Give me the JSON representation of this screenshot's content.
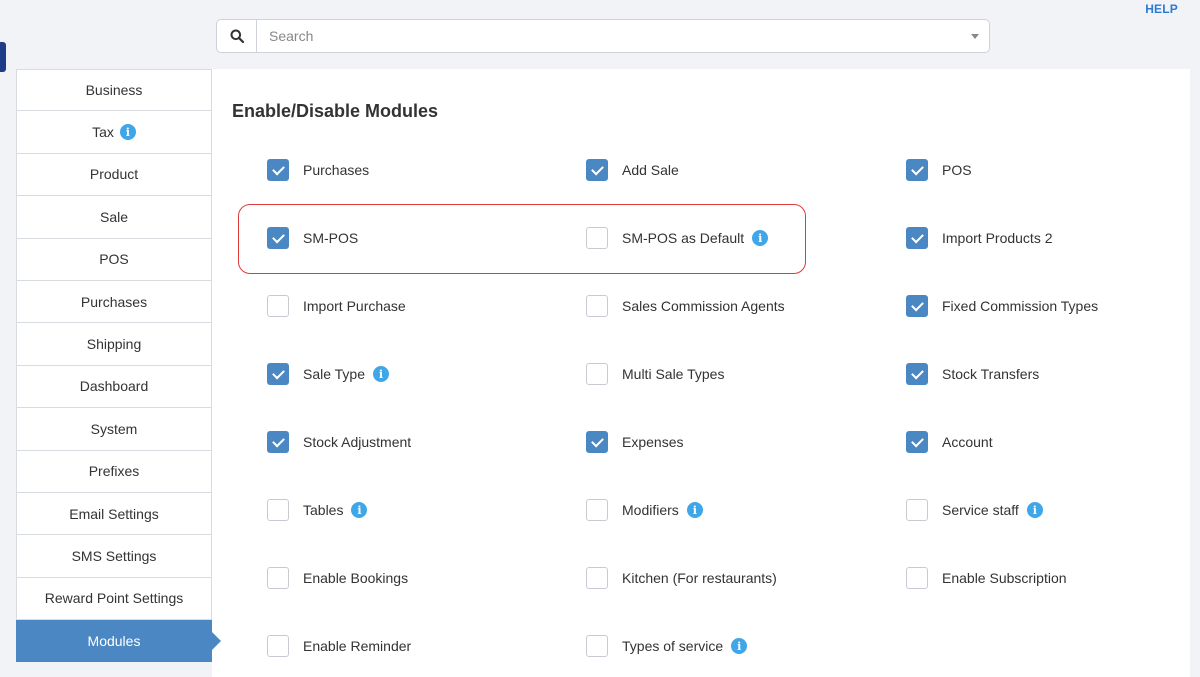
{
  "header": {
    "help_label": "HELP",
    "search_placeholder": "Search"
  },
  "sidebar": {
    "items": [
      {
        "label": "Business",
        "info": false,
        "active": false
      },
      {
        "label": "Tax",
        "info": true,
        "active": false
      },
      {
        "label": "Product",
        "info": false,
        "active": false
      },
      {
        "label": "Sale",
        "info": false,
        "active": false
      },
      {
        "label": "POS",
        "info": false,
        "active": false
      },
      {
        "label": "Purchases",
        "info": false,
        "active": false
      },
      {
        "label": "Shipping",
        "info": false,
        "active": false
      },
      {
        "label": "Dashboard",
        "info": false,
        "active": false
      },
      {
        "label": "System",
        "info": false,
        "active": false
      },
      {
        "label": "Prefixes",
        "info": false,
        "active": false
      },
      {
        "label": "Email Settings",
        "info": false,
        "active": false
      },
      {
        "label": "SMS Settings",
        "info": false,
        "active": false
      },
      {
        "label": "Reward Point Settings",
        "info": false,
        "active": false
      },
      {
        "label": "Modules",
        "info": false,
        "active": true
      }
    ]
  },
  "main": {
    "title": "Enable/Disable Modules",
    "modules": [
      {
        "label": "Purchases",
        "checked": true,
        "info": false
      },
      {
        "label": "Add Sale",
        "checked": true,
        "info": false
      },
      {
        "label": "POS",
        "checked": true,
        "info": false
      },
      {
        "label": "SM-POS",
        "checked": true,
        "info": false
      },
      {
        "label": "SM-POS as Default",
        "checked": false,
        "info": true
      },
      {
        "label": "Import Products 2",
        "checked": true,
        "info": false
      },
      {
        "label": "Import Purchase",
        "checked": false,
        "info": false
      },
      {
        "label": "Sales Commission Agents",
        "checked": false,
        "info": false
      },
      {
        "label": "Fixed Commission Types",
        "checked": true,
        "info": false
      },
      {
        "label": "Sale Type",
        "checked": true,
        "info": true
      },
      {
        "label": "Multi Sale Types",
        "checked": false,
        "info": false
      },
      {
        "label": "Stock Transfers",
        "checked": true,
        "info": false
      },
      {
        "label": "Stock Adjustment",
        "checked": true,
        "info": false
      },
      {
        "label": "Expenses",
        "checked": true,
        "info": false
      },
      {
        "label": "Account",
        "checked": true,
        "info": false
      },
      {
        "label": "Tables",
        "checked": false,
        "info": true
      },
      {
        "label": "Modifiers",
        "checked": false,
        "info": true
      },
      {
        "label": "Service staff",
        "checked": false,
        "info": true
      },
      {
        "label": "Enable Bookings",
        "checked": false,
        "info": false
      },
      {
        "label": "Kitchen (For restaurants)",
        "checked": false,
        "info": false
      },
      {
        "label": "Enable Subscription",
        "checked": false,
        "info": false
      },
      {
        "label": "Enable Reminder",
        "checked": false,
        "info": false
      },
      {
        "label": "Types of service",
        "checked": false,
        "info": true
      }
    ]
  },
  "colors": {
    "accent": "#4b88c3",
    "info": "#3fa7e8",
    "highlight": "#e03a3a",
    "help": "#2b7bd4"
  }
}
